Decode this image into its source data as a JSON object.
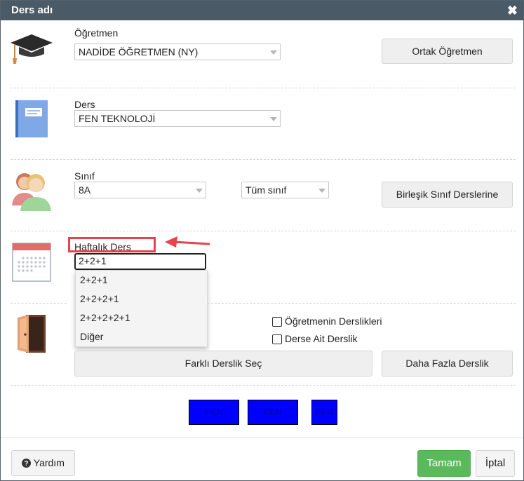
{
  "dialog": {
    "title": "Ders adı",
    "close_glyph": "✖"
  },
  "teacher": {
    "label": "Öğretmen",
    "value": "NADİDE ÖĞRETMEN (NY)",
    "button": "Ortak Öğretmen"
  },
  "lesson": {
    "label": "Ders",
    "value": "FEN TEKNOLOJİ"
  },
  "class": {
    "label": "Sınıf",
    "value": "8A",
    "group_value": "Tüm sınıf",
    "button": "Birleşik Sınıf Derslerine"
  },
  "weekly": {
    "label": "Haftalık Ders",
    "input_value": "2+2+1",
    "options": [
      "2+2+1",
      "2+2+2+1",
      "2+2+2+2+1",
      "Diğer"
    ]
  },
  "classroom": {
    "checkbox_teacher": "Öğretmenin Derslikleri",
    "checkbox_lesson": "Derse Ait Derslik",
    "choose_button": "Farklı Derslik Seç",
    "more_button": "Daha Fazla Derslik"
  },
  "slots": [
    "FEN",
    "FEN",
    "FEN"
  ],
  "footer": {
    "help": "Yardım",
    "ok": "Tamam",
    "cancel": "İptal"
  },
  "colors": {
    "titlebar": "#4a5a66",
    "ok_button": "#5cb85c",
    "slot": "#0000ff",
    "highlight": "#e8424c"
  }
}
